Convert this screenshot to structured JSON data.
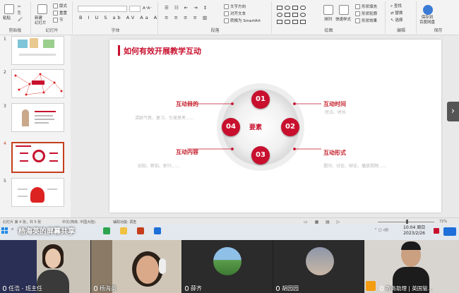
{
  "ribbon": {
    "paste": "粘贴",
    "clipboard": "剪贴板",
    "new_slide": "新建\n幻灯片",
    "reuse": "重用\n幻灯片",
    "layout": "版式",
    "reset": "重置",
    "section": "节",
    "slides_group": "幻灯片",
    "font_group": "字体",
    "paragraph_group": "段落",
    "text_direction": "文字方向",
    "align_text": "对齐文本",
    "smartart": "转换为 SmartArt",
    "arrange": "排列",
    "quick_styles": "快速样式",
    "shape_fill": "形状填充",
    "shape_outline": "形状轮廓",
    "shape_effects": "形状效果",
    "drawing_group": "绘图",
    "find": "查找",
    "replace": "替换",
    "select": "选择",
    "editing_group": "编辑",
    "save_baidu": "保存到\n百度网盘",
    "save_group": "保存"
  },
  "thumbnails": [
    {
      "num": "1"
    },
    {
      "num": "2"
    },
    {
      "num": "3"
    },
    {
      "num": "4"
    },
    {
      "num": "5"
    }
  ],
  "slide": {
    "title": "如何有效开展教学互动",
    "center": "要素",
    "circles": [
      "01",
      "02",
      "03",
      "04"
    ],
    "items": [
      {
        "title": "互动目的",
        "desc": "活跃气氛、复习、引发思考......"
      },
      {
        "title": "互动时间",
        "desc": "时点、时长"
      },
      {
        "title": "互动内容",
        "desc": "旧知、新知、即兴......"
      },
      {
        "title": "互动形式",
        "desc": "提问、讨论、辩论、播放视频......"
      }
    ]
  },
  "status": {
    "slide_info": "幻灯片 第 4 张，共 5 张",
    "language": "中文(简体, 中国大陆)",
    "accessibility": "辅助功能: 调查",
    "zoom": "72%"
  },
  "taskbar": {
    "share_banner": "杨海英的屏幕共享",
    "time": "10:04 周日",
    "date": "2023/2/26"
  },
  "participants": [
    {
      "name": "任浩 - 班主任"
    },
    {
      "name": "杨海英"
    },
    {
      "name": "薛齐"
    },
    {
      "name": "胡园园"
    },
    {
      "name": "教务助理 | 英国管..."
    }
  ],
  "colors": {
    "accent": "#c8102e",
    "ppt": "#c43e1c"
  }
}
